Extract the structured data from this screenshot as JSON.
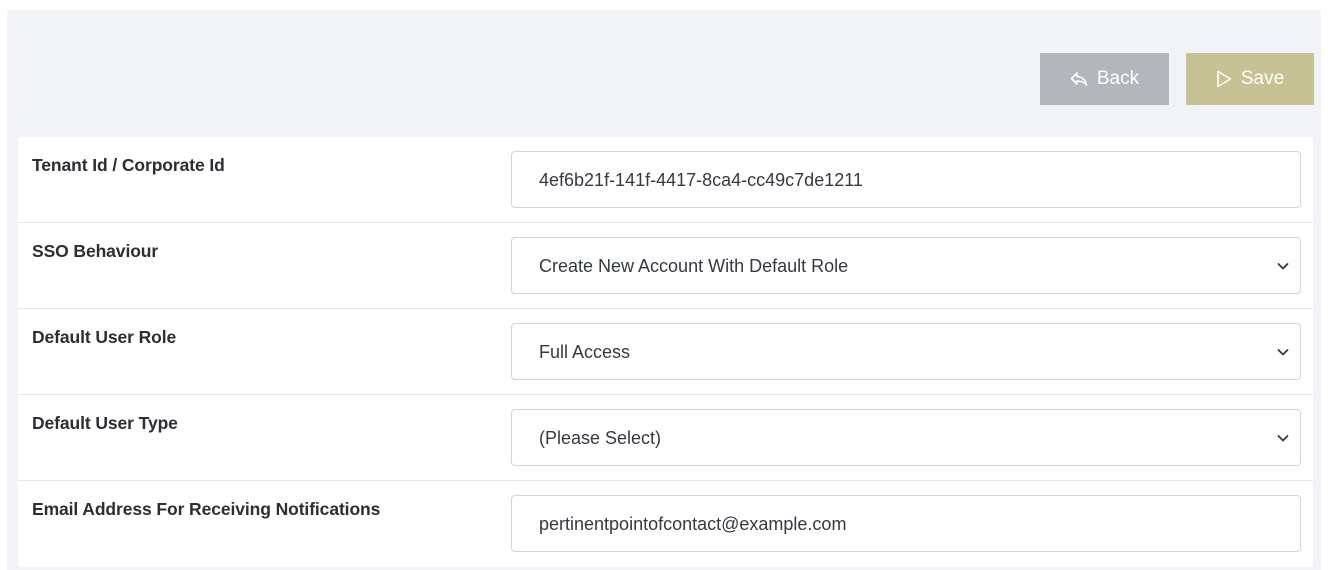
{
  "toolbar": {
    "back_label": "Back",
    "save_label": "Save",
    "back_icon": "reply-arrow-icon",
    "save_icon": "play-outline-icon",
    "back_color": "#b3b6ba",
    "save_color": "#c6c294"
  },
  "form": {
    "rows": [
      {
        "label": "Tenant Id / Corporate Id",
        "type": "text",
        "value": "4ef6b21f-141f-4417-8ca4-cc49c7de1211"
      },
      {
        "label": "SSO Behaviour",
        "type": "select",
        "value": "Create New Account With Default Role"
      },
      {
        "label": "Default User Role",
        "type": "select",
        "value": "Full Access"
      },
      {
        "label": "Default User Type",
        "type": "select",
        "value": "(Please Select)"
      },
      {
        "label": "Email Address For Receiving Notifications",
        "type": "text",
        "value": "pertinentpointofcontact@example.com"
      }
    ]
  }
}
